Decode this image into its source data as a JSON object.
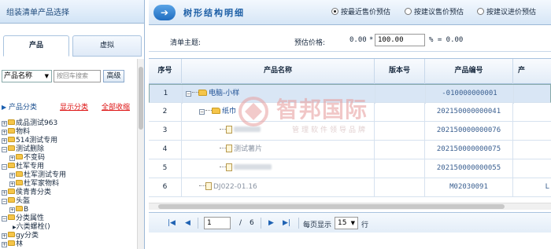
{
  "left": {
    "header_title": "组装清单产品选择",
    "tabs": [
      {
        "label": "产品",
        "active": true
      },
      {
        "label": "虚拟",
        "active": false
      }
    ],
    "search": {
      "select_value": "产品名称",
      "input_placeholder": "按回车搜索",
      "advanced_label": "高级"
    },
    "category": {
      "label": "产品分类",
      "show_label": "显示分类",
      "collapse_label": "全部收缩"
    },
    "tree": [
      {
        "label": "成品测试963",
        "level": 0,
        "expander": "+"
      },
      {
        "label": "物料",
        "level": 0,
        "expander": "+"
      },
      {
        "label": "514测试专用",
        "level": 0,
        "expander": "+"
      },
      {
        "label": "测试删除",
        "level": 0,
        "expander": "-"
      },
      {
        "label": "不变码",
        "level": 1,
        "expander": "+"
      },
      {
        "label": "杜军专用",
        "level": 0,
        "expander": "-"
      },
      {
        "label": "杜军测试专用",
        "level": 1,
        "expander": "+"
      },
      {
        "label": "杜军家物料",
        "level": 1,
        "expander": "+"
      },
      {
        "label": "侯青青分类",
        "level": 0,
        "expander": "+"
      },
      {
        "label": "头盔",
        "level": 0,
        "expander": "-"
      },
      {
        "label": "B",
        "level": 1,
        "expander": "+"
      },
      {
        "label": "分类属性",
        "level": 0,
        "expander": "-"
      },
      {
        "label": "六类螺栓()",
        "level": 1,
        "expander": ""
      },
      {
        "label": "gy分类",
        "level": 0,
        "expander": "+"
      },
      {
        "label": "林",
        "level": 0,
        "expander": "+"
      }
    ]
  },
  "right": {
    "title": "树形结构明细",
    "radios": [
      {
        "label": "按最近售价预估",
        "checked": true
      },
      {
        "label": "按建议售价预估",
        "checked": false
      },
      {
        "label": "按建议进价预估",
        "checked": false
      }
    ],
    "form": {
      "subject_label": "清单主题:",
      "estimate_label": "预估价格:",
      "estimate_value": "0.00",
      "multiply": "*",
      "factor_value": "100.00",
      "percent_text": "% = 0.00"
    },
    "columns": [
      "序号",
      "产品名称",
      "版本号",
      "产品编号",
      "产"
    ],
    "rows": [
      {
        "no": "1",
        "name": "电脑-小样",
        "version": "",
        "code": "-010000000001",
        "extra": ""
      },
      {
        "no": "2",
        "name": "纸巾",
        "version": "",
        "code": "202150000000041",
        "extra": ""
      },
      {
        "no": "3",
        "name": "",
        "version": "",
        "code": "202150000000076",
        "extra": ""
      },
      {
        "no": "4",
        "name": "测试薯片",
        "version": "",
        "code": "202150000000075",
        "extra": ""
      },
      {
        "no": "5",
        "name": "",
        "version": "",
        "code": "202150000000055",
        "extra": ""
      },
      {
        "no": "6",
        "name": "DJ022-01.16",
        "version": "",
        "code": "M02030091",
        "extra": "L"
      }
    ],
    "pager": {
      "page_value": "1",
      "slash": "/",
      "total_pages": "6",
      "per_page_label": "每页显示",
      "per_page_value": "15",
      "unit": "行"
    }
  },
  "watermark": {
    "main": "智邦国际",
    "sub": "管理软件领导品牌"
  },
  "colors": {
    "accent": "#1f6cc0",
    "link_red": "#dd1111",
    "row_selected": "#d9e6f5"
  }
}
